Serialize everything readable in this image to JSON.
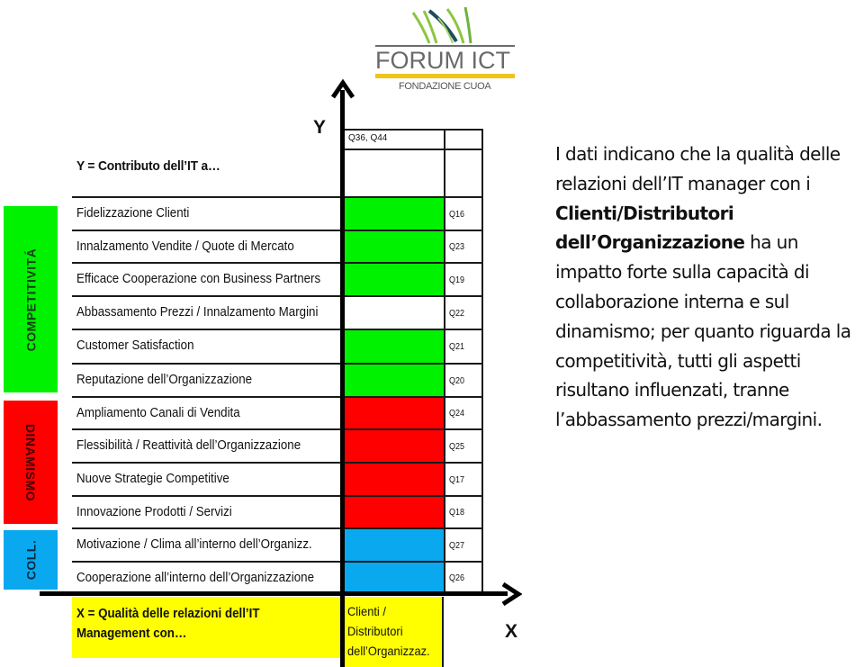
{
  "logo": {
    "title": "FORUM ICT",
    "subtitle": "FONDAZIONE CUOA",
    "colors": {
      "grass_light": "#8cc63f",
      "grass_dark": "#1f4e5a",
      "gold": "#f0c419",
      "gray": "#6a6a6a"
    }
  },
  "axes": {
    "y_label": "Y",
    "x_label": "X",
    "y_title": "Y = Contributo dell’IT a…",
    "x_title_line1": "X = Qualità delle relazioni dell’IT",
    "x_title_line2": "Management con…",
    "x_category_line1": "Clienti /",
    "x_category_line2": "Distributori",
    "x_category_line3": "dell’Organizzaz.",
    "header_questions": "Q36, Q44"
  },
  "categories": [
    {
      "label": "COMPETITIVITÁ",
      "color": "#00f200"
    },
    {
      "label": "DINAMISMO",
      "color": "#ff0000"
    },
    {
      "label": "COLL.",
      "color": "#0aa8ee"
    }
  ],
  "colors": {
    "green": "#00f200",
    "red": "#ff0000",
    "blue": "#0aa8ee",
    "white": "#ffffff",
    "yellow": "#ffff00"
  },
  "chart_data": {
    "type": "table",
    "title": "Y = Contributo dell’IT a… vs X = Qualità delle relazioni dell’IT Management con Clienti / Distributori dell’Organizzaz.",
    "column": "Clienti / Distributori dell’Organizzaz.",
    "rows": [
      {
        "label": "Fidelizzazione Clienti",
        "question": "Q16",
        "group": "COMPETITIVITÁ",
        "fill": "green"
      },
      {
        "label": "Innalzamento Vendite / Quote di Mercato",
        "question": "Q23",
        "group": "COMPETITIVITÁ",
        "fill": "green"
      },
      {
        "label": "Efficace Cooperazione con Business Partners",
        "question": "Q19",
        "group": "COMPETITIVITÁ",
        "fill": "green"
      },
      {
        "label": "Abbassamento Prezzi / Innalzamento Margini",
        "question": "Q22",
        "group": "COMPETITIVITÁ",
        "fill": "white"
      },
      {
        "label": "Customer Satisfaction",
        "question": "Q21",
        "group": "COMPETITIVITÁ",
        "fill": "green"
      },
      {
        "label": "Reputazione dell’Organizzazione",
        "question": "Q20",
        "group": "COMPETITIVITÁ",
        "fill": "green"
      },
      {
        "label": "Ampliamento Canali di Vendita",
        "question": "Q24",
        "group": "DINAMISMO",
        "fill": "red"
      },
      {
        "label": "Flessibilità / Reattività dell’Organizzazione",
        "question": "Q25",
        "group": "DINAMISMO",
        "fill": "red"
      },
      {
        "label": "Nuove Strategie Competitive",
        "question": "Q17",
        "group": "DINAMISMO",
        "fill": "red"
      },
      {
        "label": "Innovazione Prodotti / Servizi",
        "question": "Q18",
        "group": "DINAMISMO",
        "fill": "red"
      },
      {
        "label": "Motivazione / Clima all’interno dell’Organizz.",
        "question": "Q27",
        "group": "COLL.",
        "fill": "blue"
      },
      {
        "label": "Cooperazione all’interno dell’Organizzazione",
        "question": "Q26",
        "group": "COLL.",
        "fill": "blue"
      }
    ]
  },
  "note": {
    "part1": "I dati indicano che la qualità delle relazioni dell’IT manager con i ",
    "bold": "Clienti/Distributori dell’Organizzazione",
    "part2": " ha un impatto forte sulla capacità di collaborazione interna e sul dinamismo; per quanto riguarda la competitività, tutti gli aspetti risultano influenzati, tranne l’abbassamento prezzi/margini."
  }
}
